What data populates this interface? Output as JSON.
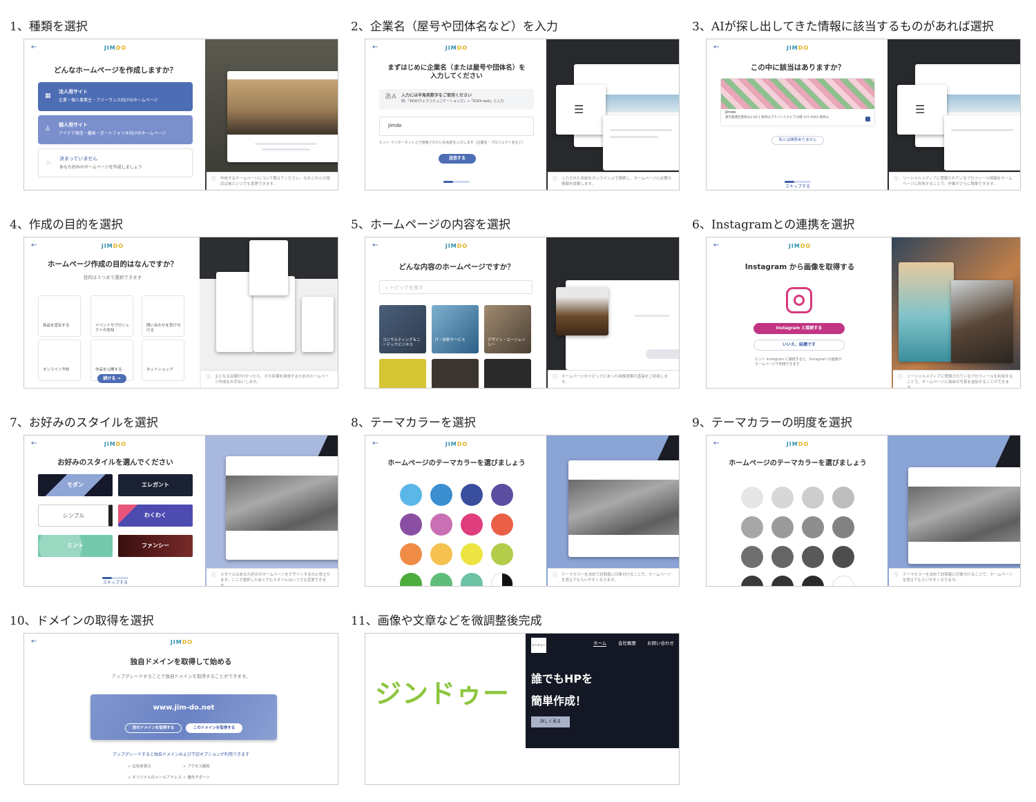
{
  "steps": [
    {
      "caption": "1、種類を選択",
      "question": "どんなホームページを作成しますか？",
      "options": [
        {
          "title": "法人用サイト",
          "desc": "企業・個人事業主・フリーランス向けのホームページ",
          "color": "#4d6db5"
        },
        {
          "title": "個人用サイト",
          "desc": "アイデア発信・趣味・ポートフォリオ向けのホームページ",
          "color": "#7b8fcd"
        },
        {
          "title": "決まっていません",
          "desc": "あなた好みのホームページを作成しましょう",
          "color": "#ffffff"
        }
      ],
      "note": "作成するホームページについて教えてください。なおこれらの項目は後といつでも変更できます。"
    },
    {
      "caption": "2、企業名（屋号や団体名など）を入力",
      "question": "まずはじめに企業名（または屋号や団体名）を入力してください",
      "hint_title": "入力には半角英数字をご使用ください",
      "hint_example": "例：「KDDIウェブコミュニケーションズ」→「KDDI-web」と入力",
      "input_value": "Jimdo",
      "input_hint": "ヒント インターネット上で検索されたいお名前を入力します（企業名・プロジェクト名など）",
      "submit": "送信する",
      "note": "入力された名前をオンライン上で検索し、ホームページに必要な情報を提案します。"
    },
    {
      "caption": "3、AIが探し出してきた情報に該当するものがあれば選択",
      "question": "この中に該当はありますか？",
      "result_name": "Jimdo",
      "result_addr": "東京都港区南青山2-26-1 南青山ブライトスクエア10階 107-0062 南青山",
      "none_button": "私とは関係ありません",
      "skip": "スキップする",
      "note": "ソーシャルメディアに登録されているプロフィール情報をホームページに利用することで、作業がさらに簡単できます。"
    },
    {
      "caption": "4、作成の目的を選択",
      "question": "ホームページ作成の目的はなんですか？",
      "sub": "目的は３つまで選択できます",
      "tiles": [
        "商品を宣伝する",
        "イベントやプロジェクトの告知",
        "問い合わせを受け付ける",
        "オンライン予約",
        "作品を公開する",
        "ネットショップ"
      ],
      "continue": "続ける",
      "note": "主となる目標がわかったら、その目標を達成するためのホームページ作成をお手伝いします。"
    },
    {
      "caption": "5、ホームページの内容を選択",
      "question": "どんな内容のホームページですか？",
      "search_placeholder": "トピックを探す",
      "topics": [
        "コンサルティング＆ニーデックビジネス",
        "IT・技術サービス",
        "デザイン・エージェンシー",
        "",
        "",
        ""
      ],
      "note": "ホームページのトピックにあった画像提案の直接をご利用します。"
    },
    {
      "caption": "6、Instagramとの連携を選択",
      "question": "Instagram から画像を取得する",
      "connect": "Instagram と接続する",
      "decline": "いいえ、結構です",
      "hint": "ヒント Instagram に接続すると、Instagram の画像がホームページで利用できます",
      "note": "ソーシャルメディアに登録されているプロフィールを利用することで、ホームページに独自の写真を追加することができます。"
    },
    {
      "caption": "7、お好みのスタイルを選択",
      "question": "お好みのスタイルを選んでください",
      "styles": [
        "モダン",
        "エレガント",
        "シンプル",
        "わくわく",
        "ミント",
        "ファンシー"
      ],
      "skip": "スキップする",
      "note": "スタイルはあなた好みのホームページをデザインするのに役立ちます。ここで選択したあとでもスタイルはいつでも変更できます。"
    },
    {
      "caption": "8、テーマカラーを選択",
      "question": "ホームページのテーマカラーを選びましょう",
      "colors": [
        "#5bb7e8",
        "#3b8fd1",
        "#3a4e9e",
        "#5b4ea0",
        "#8a4fa3",
        "#c96fb4",
        "#de3e7b",
        "#ea6047",
        "#ef8c46",
        "#f5c14f",
        "#ede443",
        "#b3cc4a",
        "#4cad3d",
        "#5fbd79",
        "#6cc3a4",
        "#ffffff"
      ],
      "note": "テーマカラーを決めて訪問者に印象付けることで、ホームページを覚えてもらいやすくなります。"
    },
    {
      "caption": "9、テーマカラーの明度を選択",
      "question": "ホームページのテーマカラーを選びましょう",
      "shades": [
        "#e6e6e6",
        "#d7d7d7",
        "#cdcdcd",
        "#bebebe",
        "#a7a7a7",
        "#9b9b9b",
        "#8e8e8e",
        "#828282",
        "#6f6f6f",
        "#656565",
        "#595959",
        "#4d4d4d",
        "#3a3a3a",
        "#333333",
        "#2b2b2b",
        "#ffffff"
      ],
      "more": "…",
      "note": "テーマカラーを決めて訪問者に印象付けることで、ホームページを覚えてもらいやすくなります。"
    },
    {
      "caption": "10、ドメインの取得を選択",
      "question": "独自ドメインを取得して始める",
      "sub": "アップグレードすることで独自ドメインを取得することができます。",
      "domain": "www.jim-do.net",
      "other_domain": "別のドメインを取得する",
      "this_domain": "このドメインを取得する",
      "upgrade": "アップグレードすると独自ドメインおよび下記オプションが利用できます",
      "features": [
        "広告非表示",
        "アクセス解析",
        "オリジナルのメールアドレス",
        "優先サポート"
      ]
    },
    {
      "caption": "11、画像や文章などを微調整後完成",
      "logo": "ジンドゥー",
      "nav": [
        "ホーム",
        "会社概要",
        "お問い合わせ"
      ],
      "headline1": "誰でもHPを",
      "headline2": "簡単作成！",
      "detail": "詳しく見る",
      "small_logo": "ジンドゥー"
    }
  ],
  "brand": {
    "logo_a": "JIM",
    "logo_b": "DO"
  },
  "colors": {
    "accent": "#3e5ca8",
    "instagram": "#c13584",
    "dark": "#141824",
    "lime": "#8dc63f"
  }
}
